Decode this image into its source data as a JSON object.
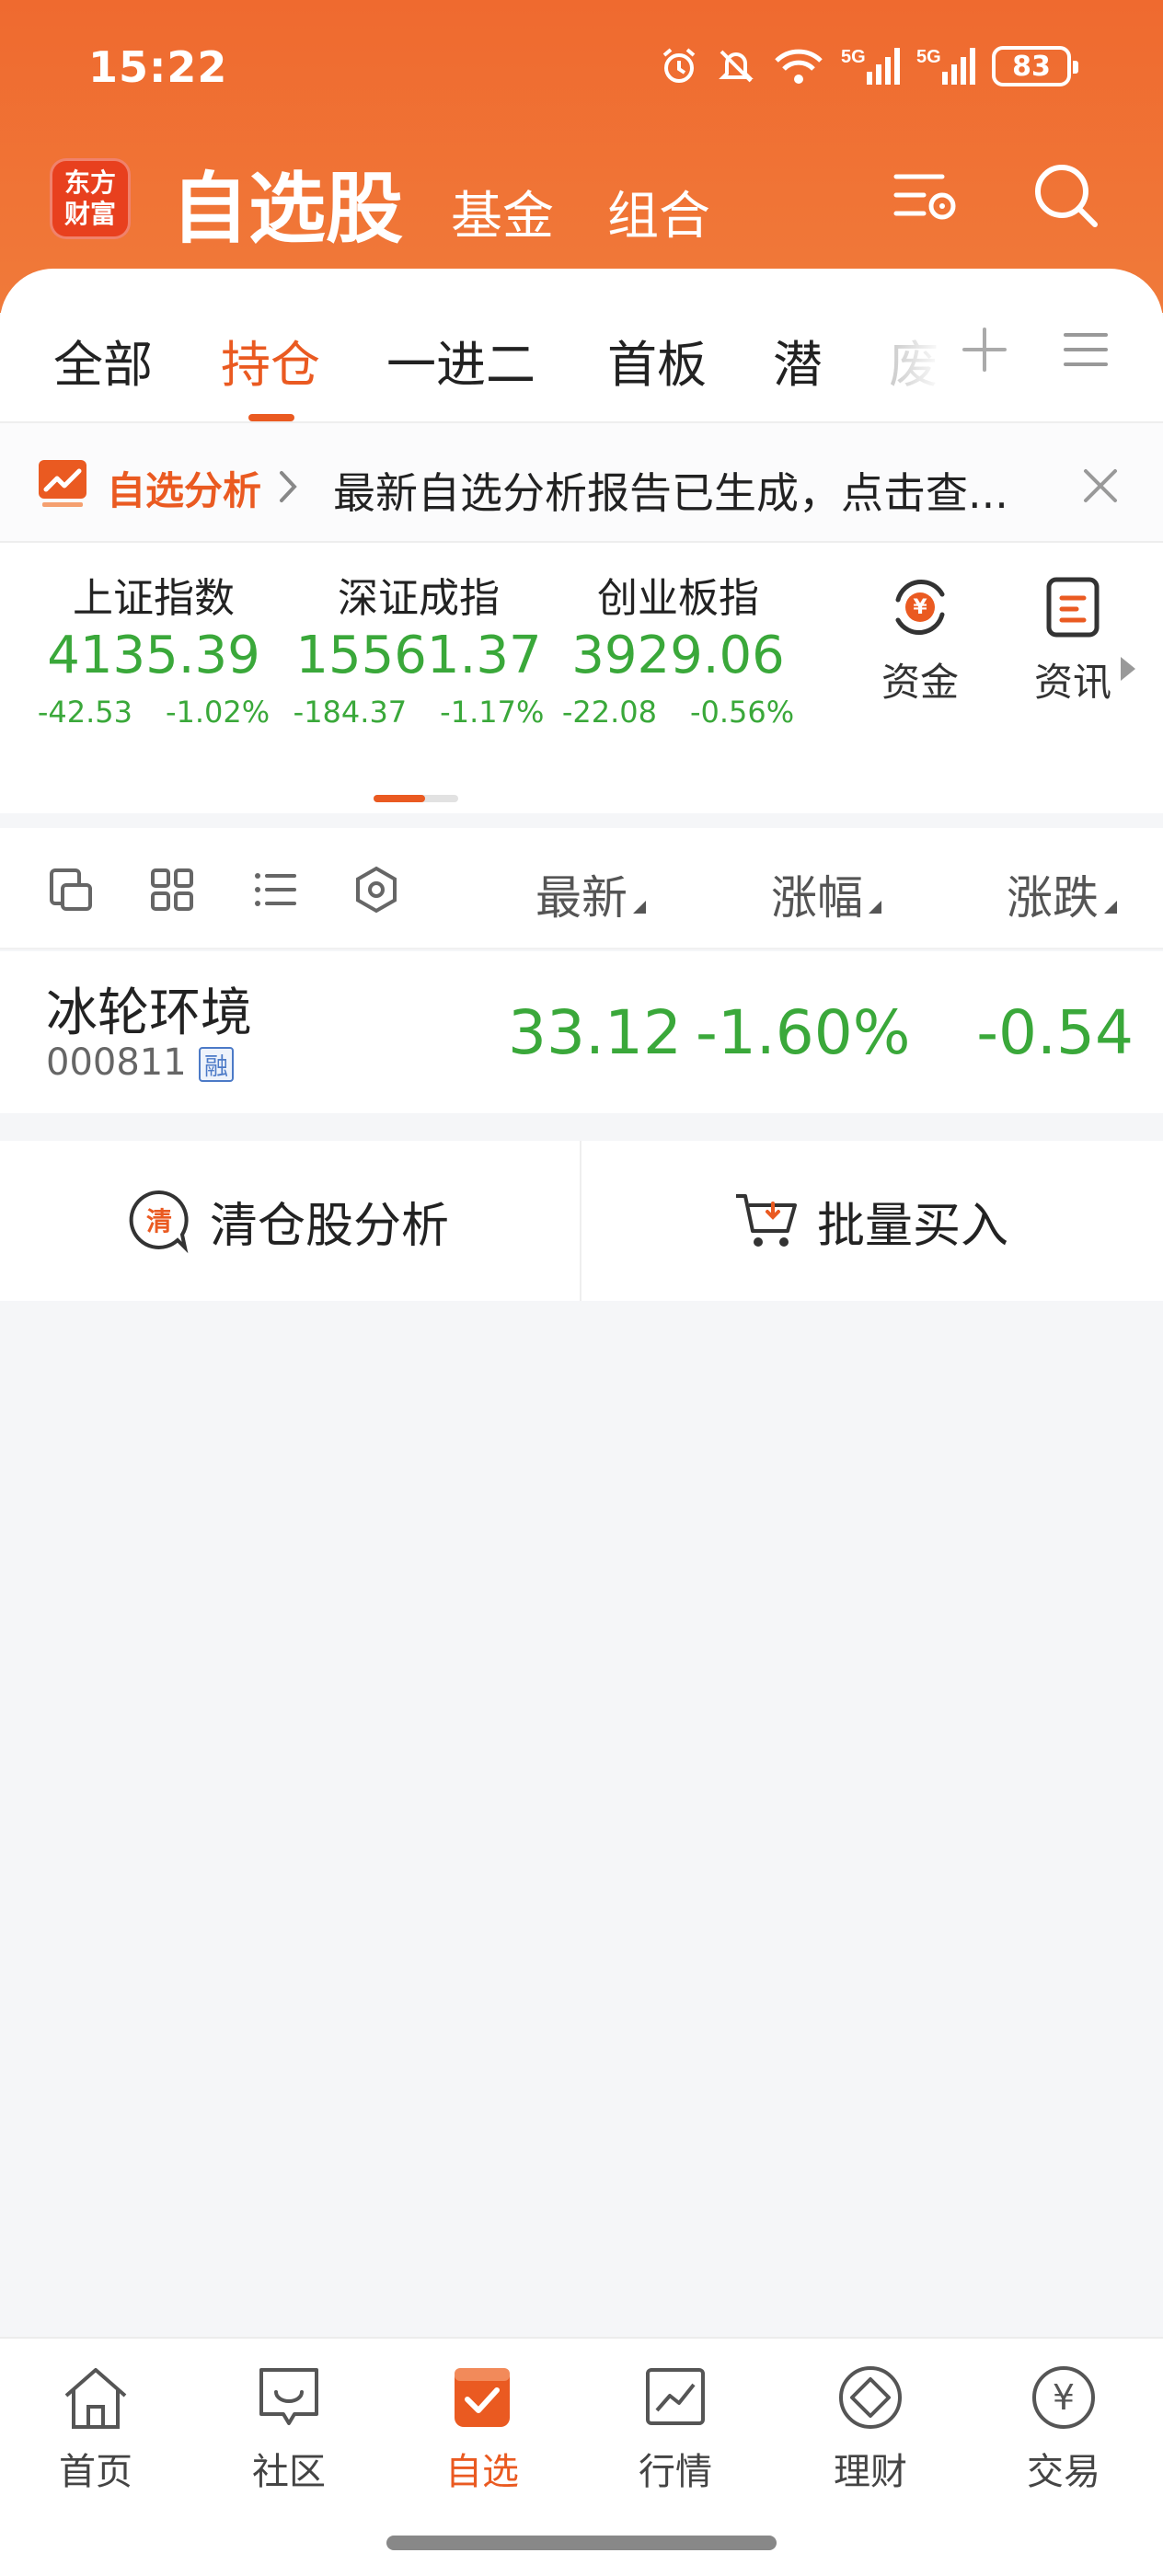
{
  "status_bar": {
    "time": "15:22",
    "battery": "83",
    "net1": "5G",
    "net2": "5G"
  },
  "header": {
    "logo_line1": "东方",
    "logo_line2": "财富",
    "title": "自选股",
    "tab_fund": "基金",
    "tab_combo": "组合"
  },
  "tabs": [
    {
      "label": "全部"
    },
    {
      "label": "持仓"
    },
    {
      "label": "一进二"
    },
    {
      "label": "首板"
    },
    {
      "label": "潜"
    },
    {
      "label": "废"
    }
  ],
  "banner": {
    "tag": "自选分析",
    "text": "最新自选分析报告已生成，点击查..."
  },
  "indices": [
    {
      "name": "上证指数",
      "value": "4135.39",
      "change": "-42.53",
      "pct": "-1.02%"
    },
    {
      "name": "深证成指",
      "value": "15561.37",
      "change": "-184.37",
      "pct": "-1.17%"
    },
    {
      "name": "创业板指",
      "value": "3929.06",
      "change": "-22.08",
      "pct": "-0.56%"
    }
  ],
  "index_tools": {
    "fund": "资金",
    "news": "资讯"
  },
  "list_columns": {
    "latest": "最新",
    "pct": "涨幅",
    "change": "涨跌"
  },
  "stocks": [
    {
      "name": "冰轮环境",
      "code": "000811",
      "badge": "融",
      "price": "33.12",
      "pct": "-1.60%",
      "change": "-0.54"
    }
  ],
  "actions": {
    "clear": "清仓股分析",
    "clear_badge": "清",
    "buy": "批量买入"
  },
  "bottom_nav": [
    {
      "label": "首页"
    },
    {
      "label": "社区"
    },
    {
      "label": "自选"
    },
    {
      "label": "行情"
    },
    {
      "label": "理财"
    },
    {
      "label": "交易"
    }
  ],
  "colors": {
    "brand": "#ea5a21",
    "down": "#3aa83a"
  }
}
